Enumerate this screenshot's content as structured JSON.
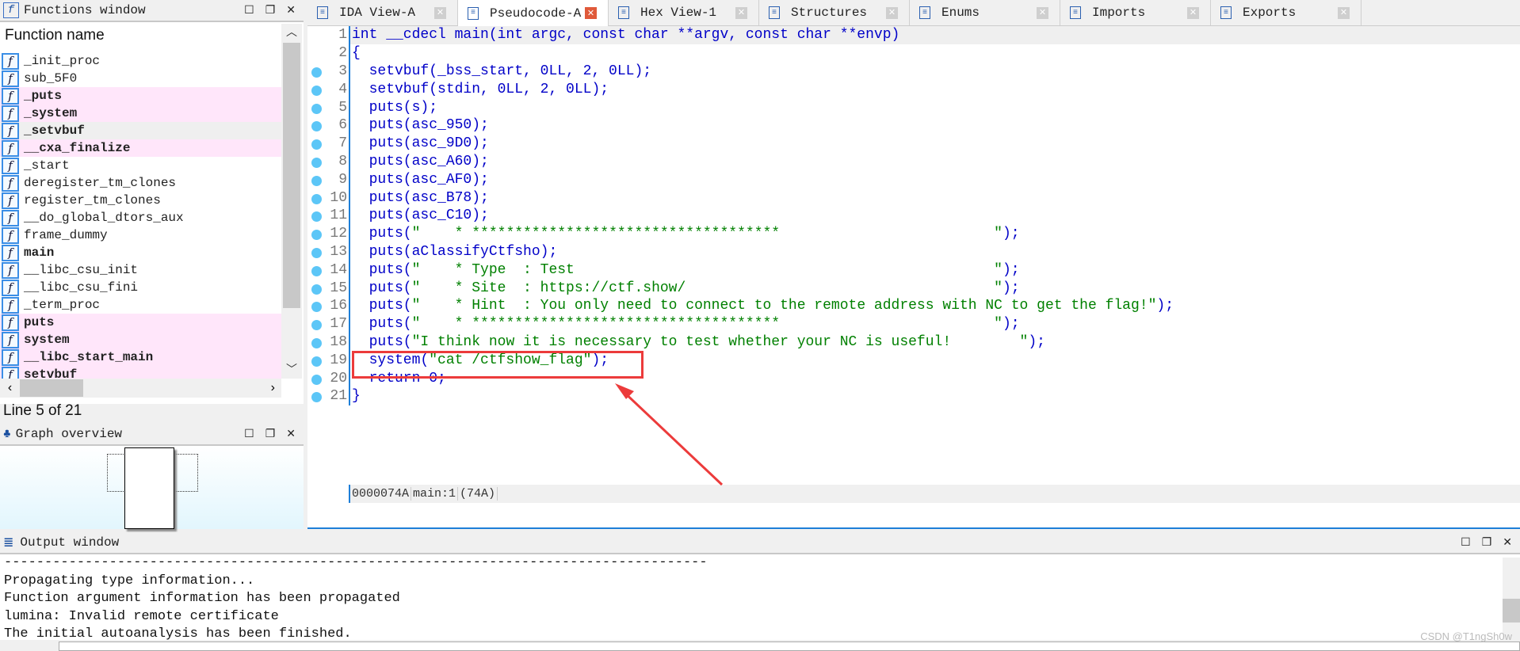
{
  "functions_window": {
    "title": "Functions window",
    "column_header": "Function name",
    "items": [
      {
        "name": "_init_proc",
        "style": "normal"
      },
      {
        "name": "sub_5F0",
        "style": "normal"
      },
      {
        "name": "_puts",
        "style": "pink"
      },
      {
        "name": "_system",
        "style": "pink"
      },
      {
        "name": "_setvbuf",
        "style": "selected"
      },
      {
        "name": "__cxa_finalize",
        "style": "pink"
      },
      {
        "name": "_start",
        "style": "normal"
      },
      {
        "name": "deregister_tm_clones",
        "style": "normal"
      },
      {
        "name": "register_tm_clones",
        "style": "normal"
      },
      {
        "name": "__do_global_dtors_aux",
        "style": "normal"
      },
      {
        "name": "frame_dummy",
        "style": "normal"
      },
      {
        "name": "main",
        "style": "bold"
      },
      {
        "name": "__libc_csu_init",
        "style": "normal"
      },
      {
        "name": "__libc_csu_fini",
        "style": "normal"
      },
      {
        "name": "_term_proc",
        "style": "normal"
      },
      {
        "name": "puts",
        "style": "pink"
      },
      {
        "name": "system",
        "style": "pink"
      },
      {
        "name": "__libc_start_main",
        "style": "pink"
      },
      {
        "name": "setvbuf",
        "style": "pink"
      }
    ],
    "line_info": "Line 5 of 21"
  },
  "graph_overview": {
    "title": "Graph overview"
  },
  "tabs": [
    {
      "label": "IDA View-A",
      "active": false
    },
    {
      "label": "Pseudocode-A",
      "active": true
    },
    {
      "label": "Hex View-1",
      "active": false
    },
    {
      "label": "Structures",
      "active": false
    },
    {
      "label": "Enums",
      "active": false
    },
    {
      "label": "Imports",
      "active": false
    },
    {
      "label": "Exports",
      "active": false
    }
  ],
  "code_lines": [
    {
      "n": "1",
      "dot": false,
      "parts": [
        [
          "kw",
          "int __cdecl main(int argc, const char **argv, const char **envp)"
        ]
      ]
    },
    {
      "n": "2",
      "dot": false,
      "parts": [
        [
          "kw",
          "{"
        ]
      ]
    },
    {
      "n": "3",
      "dot": true,
      "parts": [
        [
          "kw",
          "  setvbuf(_bss_start, 0LL, 2, 0LL);"
        ]
      ]
    },
    {
      "n": "4",
      "dot": true,
      "parts": [
        [
          "kw",
          "  setvbuf(stdin, 0LL, 2, 0LL);"
        ]
      ]
    },
    {
      "n": "5",
      "dot": true,
      "parts": [
        [
          "kw",
          "  puts(s);"
        ]
      ]
    },
    {
      "n": "6",
      "dot": true,
      "parts": [
        [
          "kw",
          "  puts(asc_950);"
        ]
      ]
    },
    {
      "n": "7",
      "dot": true,
      "parts": [
        [
          "kw",
          "  puts(asc_9D0);"
        ]
      ]
    },
    {
      "n": "8",
      "dot": true,
      "parts": [
        [
          "kw",
          "  puts(asc_A60);"
        ]
      ]
    },
    {
      "n": "9",
      "dot": true,
      "parts": [
        [
          "kw",
          "  puts(asc_AF0);"
        ]
      ]
    },
    {
      "n": "10",
      "dot": true,
      "parts": [
        [
          "kw",
          "  puts(asc_B78);"
        ]
      ]
    },
    {
      "n": "11",
      "dot": true,
      "parts": [
        [
          "kw",
          "  puts(asc_C10);"
        ]
      ]
    },
    {
      "n": "12",
      "dot": true,
      "parts": [
        [
          "kw",
          "  puts("
        ],
        [
          "st",
          "\"    * ************************************                         \""
        ],
        [
          "kw",
          ");"
        ]
      ]
    },
    {
      "n": "13",
      "dot": true,
      "parts": [
        [
          "kw",
          "  puts(aClassifyCtfsho);"
        ]
      ]
    },
    {
      "n": "14",
      "dot": true,
      "parts": [
        [
          "kw",
          "  puts("
        ],
        [
          "st",
          "\"    * Type  : Test                                                 \""
        ],
        [
          "kw",
          ");"
        ]
      ]
    },
    {
      "n": "15",
      "dot": true,
      "parts": [
        [
          "kw",
          "  puts("
        ],
        [
          "st",
          "\"    * Site  : https://ctf.show/                                    \""
        ],
        [
          "kw",
          ");"
        ]
      ]
    },
    {
      "n": "16",
      "dot": true,
      "parts": [
        [
          "kw",
          "  puts("
        ],
        [
          "st",
          "\"    * Hint  : You only need to connect to the remote address with NC to get the flag!\""
        ],
        [
          "kw",
          ");"
        ]
      ]
    },
    {
      "n": "17",
      "dot": true,
      "parts": [
        [
          "kw",
          "  puts("
        ],
        [
          "st",
          "\"    * ************************************                         \""
        ],
        [
          "kw",
          ");"
        ]
      ]
    },
    {
      "n": "18",
      "dot": true,
      "parts": [
        [
          "kw",
          "  puts("
        ],
        [
          "st",
          "\"I think now it is necessary to test whether your NC is useful!        \""
        ],
        [
          "kw",
          ");"
        ]
      ]
    },
    {
      "n": "19",
      "dot": true,
      "parts": [
        [
          "kw",
          "  system("
        ],
        [
          "st",
          "\"cat /ctfshow_flag\""
        ],
        [
          "kw",
          ");"
        ]
      ]
    },
    {
      "n": "20",
      "dot": true,
      "parts": [
        [
          "kw",
          "  return 0;"
        ]
      ]
    },
    {
      "n": "21",
      "dot": true,
      "parts": [
        [
          "kw",
          "}"
        ]
      ]
    }
  ],
  "status_bar": {
    "address": "0000074A",
    "location": "main:1",
    "offset": "(74A)"
  },
  "output_window": {
    "title": "Output window",
    "lines": [
      "---------------------------------------------------------------------------------------",
      "Propagating type information...",
      "Function argument information has been propagated",
      "lumina: Invalid remote certificate",
      "The initial autoanalysis has been finished."
    ]
  },
  "watermark": "CSDN @T1ngSh0w",
  "colors": {
    "highlight_box": "#ec3b3b",
    "keyword": "#0000c8",
    "string": "#008000",
    "import_row": "#ffe6fa",
    "accent": "#1e7fd8"
  }
}
